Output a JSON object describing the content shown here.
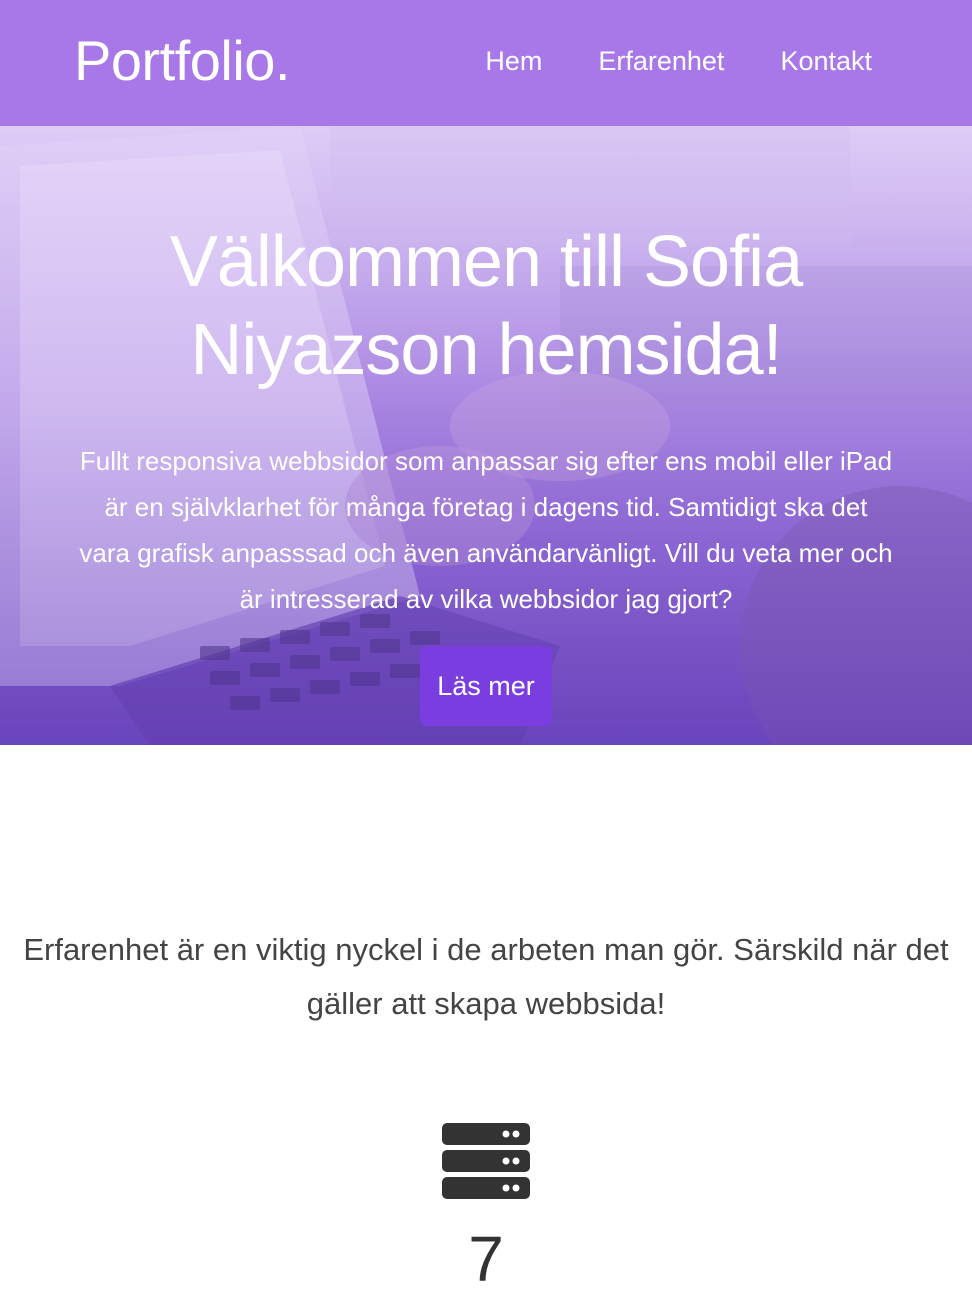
{
  "header": {
    "brand": "Portfolio.",
    "nav": [
      {
        "label": "Hem"
      },
      {
        "label": "Erfarenhet"
      },
      {
        "label": "Kontakt"
      }
    ]
  },
  "hero": {
    "title": "Välkommen till Sofia Niyazson hemsida!",
    "text": "Fullt responsiva webbsidor som anpassar sig efter ens mobil eller iPad är en självklarhet för många företag i dagens tid. Samtidigt ska det vara grafisk anpasssad och även användarvänligt. Vill du veta mer och är intresserad av vilka webbsidor jag gjort?",
    "button_label": "Läs mer",
    "background_image": "laptop-typing-photo"
  },
  "experience": {
    "intro": "Erfarenhet är en viktig nyckel i de arbeten man gör. Särskild när det gäller att skapa webbsida!",
    "stat_icon": "server-icon",
    "stat_number": "7"
  },
  "colors": {
    "header_bg": "#a878e8",
    "button_bg": "#7a3ee0",
    "text_dark": "#444444"
  }
}
